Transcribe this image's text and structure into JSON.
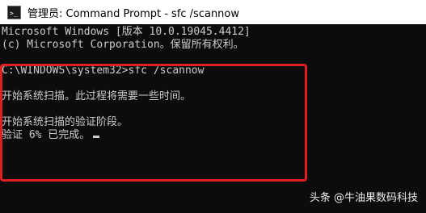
{
  "window": {
    "title": "管理员: Command Prompt - sfc  /scannow",
    "icon": "cmd-icon",
    "icon_glyph": ">_"
  },
  "console": {
    "lines": [
      "Microsoft Windows [版本 10.0.19045.4412]",
      "(c) Microsoft Corporation。保留所有权利。",
      "",
      "C:\\WINDOWS\\system32>sfc /scannow",
      "",
      "开始系统扫描。此过程将需要一些时间。",
      "",
      "开始系统扫描的验证阶段。",
      "验证 6% 已完成。"
    ],
    "progress_percent": 6
  },
  "annotation": {
    "highlight_color": "#e02020"
  },
  "watermark": {
    "text": "头条 @牛油果数码科技"
  },
  "colors": {
    "console_bg": "#0c0c0c",
    "console_text": "#cccccc",
    "titlebar_bg": "#ffffff"
  }
}
